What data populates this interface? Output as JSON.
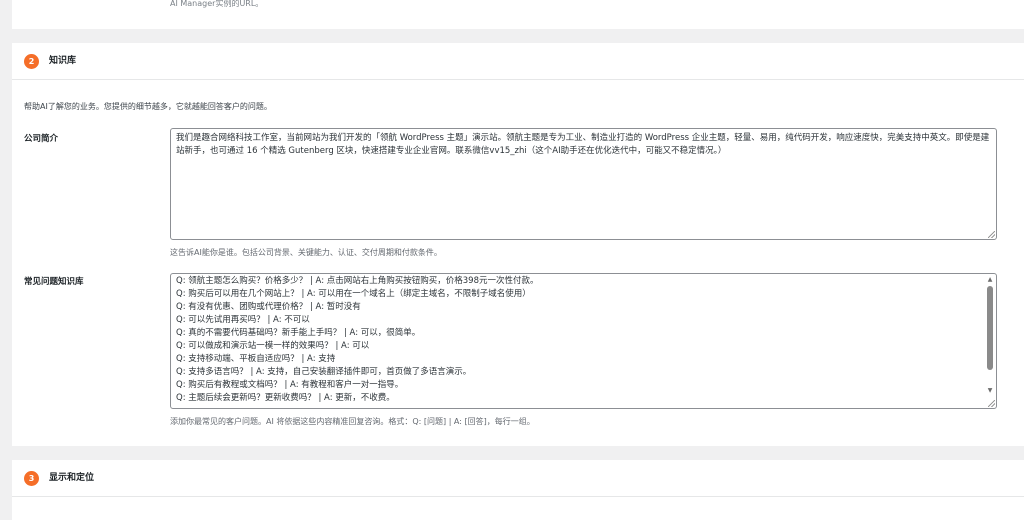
{
  "top_section": {
    "help_text": "AI Manager实例的URL。"
  },
  "knowledge_section": {
    "step": "2",
    "title": "知识库",
    "intro": "帮助AI了解您的业务。您提供的细节越多，它就越能回答客户的问题。",
    "company_label": "公司简介",
    "company_value": "我们是趣合网络科技工作室，当前网站为我们开发的「领航 WordPress 主题」演示站。领航主题是专为工业、制造业打造的 WordPress 企业主题，轻量、易用，纯代码开发，响应速度快，完美支持中英文。即使是建站新手，也可通过 16 个精选 Gutenberg 区块，快速搭建专业企业官网。联系微信vv15_zhi（这个AI助手还在优化迭代中，可能又不稳定情况。）",
    "company_help": "这告诉AI能你是谁。包括公司背景、关键能力、认证、交付周期和付款条件。",
    "faq_label": "常见问题知识库",
    "faq_lines": [
      "Q: 领航主题怎么购买？价格多少？ | A: 点击网站右上角购买按钮购买，价格398元一次性付款。",
      "Q: 购买后可以用在几个网站上？ | A: 可以用在一个域名上（绑定主域名，不限制子域名使用）",
      "Q: 有没有优惠、团购或代理价格？ | A: 暂时没有",
      "Q: 可以先试用再买吗？ | A: 不可以",
      "Q: 真的不需要代码基础吗？新手能上手吗？ | A: 可以，很简单。",
      "Q: 可以做成和演示站一模一样的效果吗？ | A: 可以",
      "Q: 支持移动端、平板自适应吗？ | A: 支持",
      "Q: 支持多语言吗？ | A: 支持，自己安装翻译插件即可，首页做了多语言演示。",
      "Q: 购买后有教程或文档吗？ | A: 有教程和客户一对一指导。",
      "Q: 主题后续会更新吗？更新收费吗？ | A: 更新，不收费。"
    ],
    "faq_help": "添加你最常见的客户问题。AI 将依据这些内容精准回复咨询。格式：Q: [问题] | A: [回答]，每行一组。"
  },
  "display_section": {
    "step": "3",
    "title": "显示和定位"
  },
  "colors": {
    "accent": "#f56e28",
    "page_bg": "#f0f0f1",
    "panel_bg": "#ffffff"
  }
}
